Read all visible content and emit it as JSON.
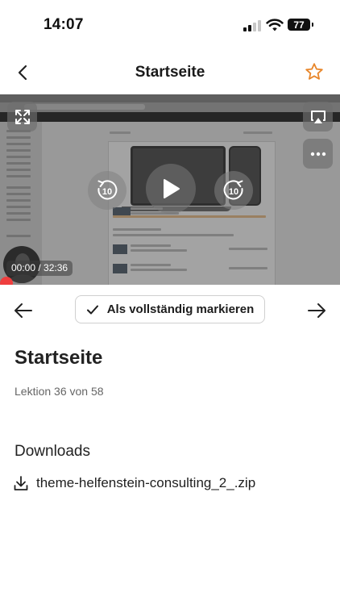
{
  "status_bar": {
    "time": "14:07",
    "battery": "77"
  },
  "nav": {
    "title": "Startseite",
    "back_icon": "chevron-left-icon",
    "star_icon": "star-outline-icon",
    "accent_color": "#e8862a"
  },
  "video": {
    "timecode": "00:00 / 32:36",
    "rewind_seconds": "10",
    "forward_seconds": "10",
    "progress_fraction": 0,
    "scrub_color": "#ef3e3e"
  },
  "lesson_nav": {
    "complete_label": "Als vollständig markieren"
  },
  "lesson": {
    "title": "Startseite",
    "subtitle": "Lektion 36 von 58"
  },
  "downloads": {
    "heading": "Downloads",
    "items": [
      {
        "name": "theme-helfenstein-consulting_2_.zip",
        "icon": "download-icon"
      }
    ]
  }
}
